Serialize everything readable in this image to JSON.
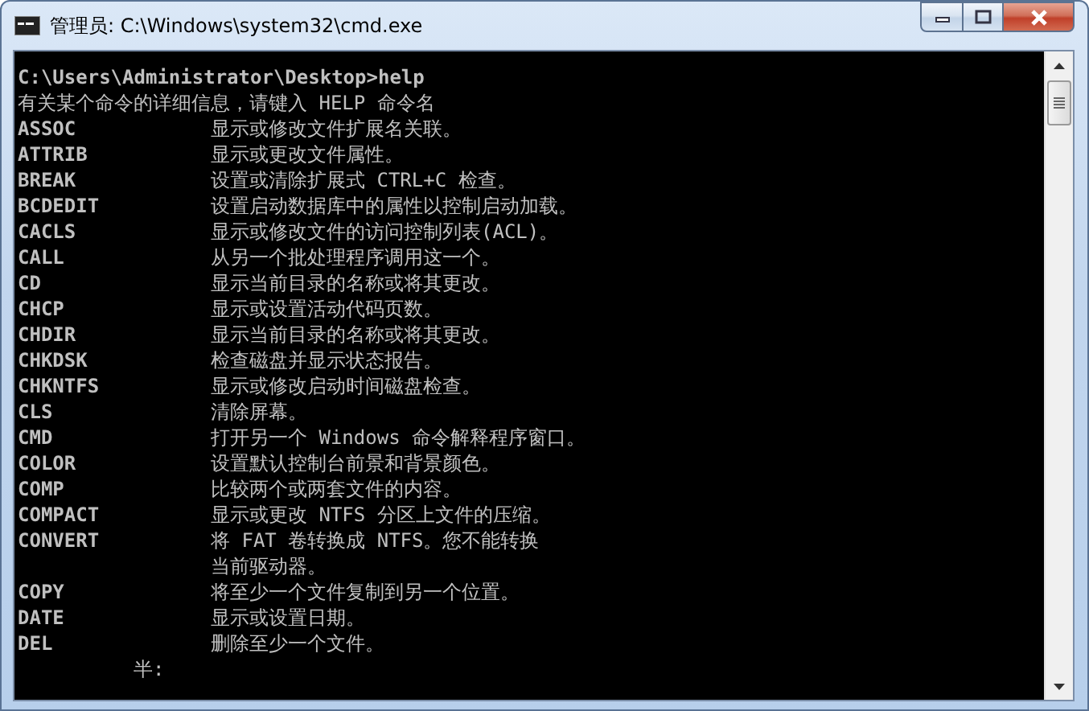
{
  "window": {
    "title": "管理员: C:\\Windows\\system32\\cmd.exe"
  },
  "console": {
    "prompt": "C:\\Users\\Administrator\\Desktop>help",
    "intro": "有关某个命令的详细信息，请键入 HELP 命令名",
    "commands": [
      {
        "name": "ASSOC",
        "description": "显示或修改文件扩展名关联。"
      },
      {
        "name": "ATTRIB",
        "description": "显示或更改文件属性。"
      },
      {
        "name": "BREAK",
        "description": "设置或清除扩展式 CTRL+C 检查。"
      },
      {
        "name": "BCDEDIT",
        "description": "设置启动数据库中的属性以控制启动加载。"
      },
      {
        "name": "CACLS",
        "description": "显示或修改文件的访问控制列表(ACL)。"
      },
      {
        "name": "CALL",
        "description": "从另一个批处理程序调用这一个。"
      },
      {
        "name": "CD",
        "description": "显示当前目录的名称或将其更改。"
      },
      {
        "name": "CHCP",
        "description": "显示或设置活动代码页数。"
      },
      {
        "name": "CHDIR",
        "description": "显示当前目录的名称或将其更改。"
      },
      {
        "name": "CHKDSK",
        "description": "检查磁盘并显示状态报告。"
      },
      {
        "name": "CHKNTFS",
        "description": "显示或修改启动时间磁盘检查。"
      },
      {
        "name": "CLS",
        "description": "清除屏幕。"
      },
      {
        "name": "CMD",
        "description": "打开另一个 Windows 命令解释程序窗口。"
      },
      {
        "name": "COLOR",
        "description": "设置默认控制台前景和背景颜色。"
      },
      {
        "name": "COMP",
        "description": "比较两个或两套文件的内容。"
      },
      {
        "name": "COMPACT",
        "description": "显示或更改 NTFS 分区上文件的压缩。"
      },
      {
        "name": "CONVERT",
        "description": "将 FAT 卷转换成 NTFS。您不能转换",
        "continuation": "当前驱动器。"
      },
      {
        "name": "COPY",
        "description": "将至少一个文件复制到另一个位置。"
      },
      {
        "name": "DATE",
        "description": "显示或设置日期。"
      },
      {
        "name": "DEL",
        "description": "删除至少一个文件。"
      }
    ],
    "ime_status": "半:"
  }
}
